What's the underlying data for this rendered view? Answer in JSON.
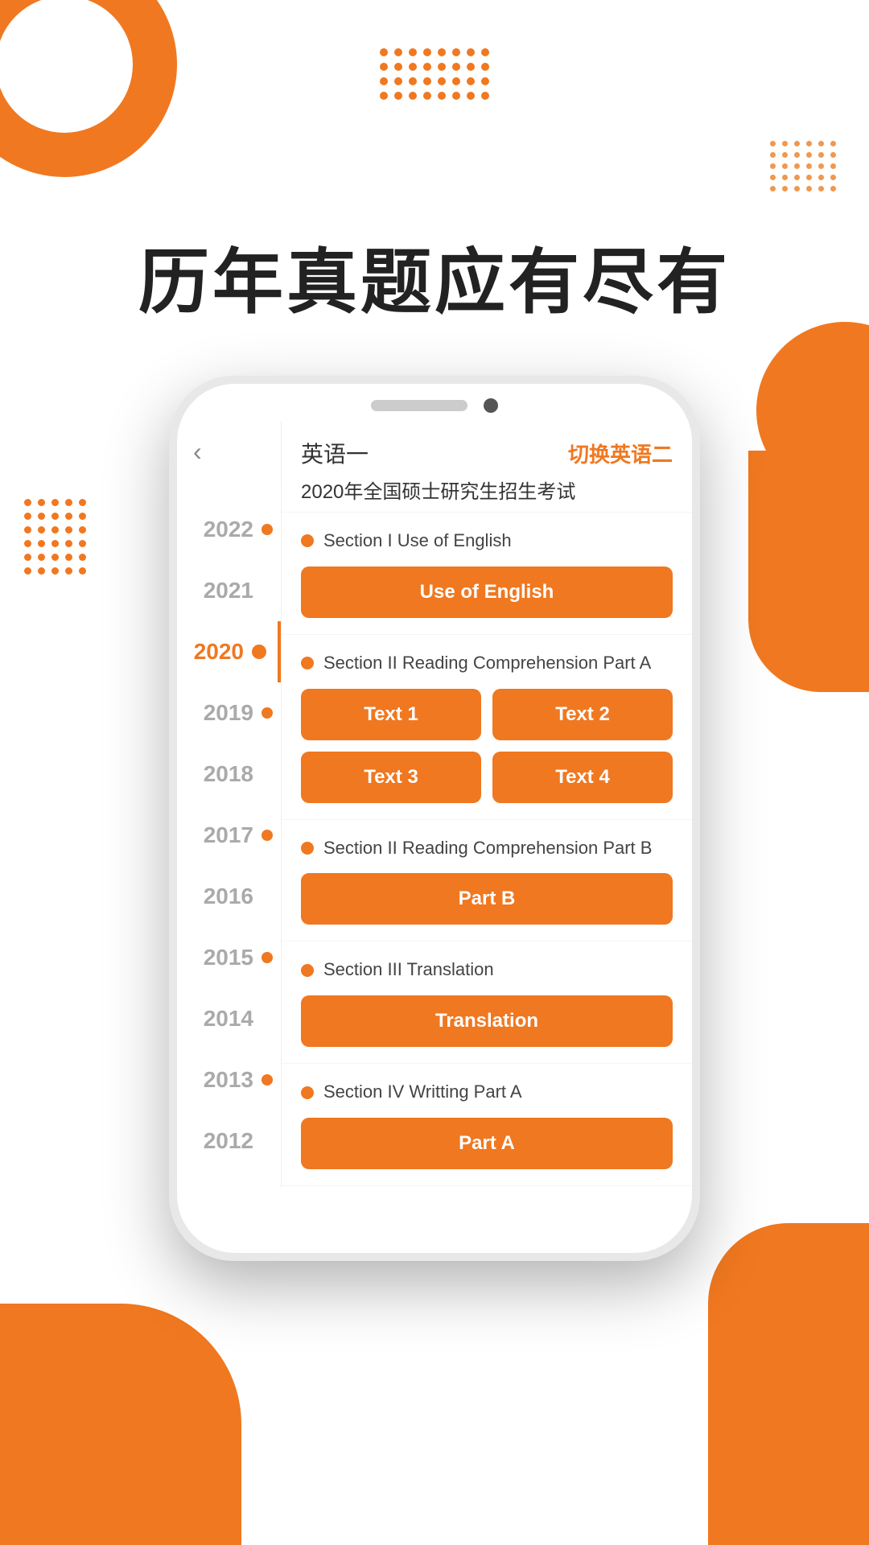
{
  "hero": {
    "title": "历年真题应有尽有"
  },
  "phone": {
    "header": {
      "exam_type": "英语一",
      "switch_label": "切换英语二",
      "exam_title": "2020年全国硕士研究生招生考试"
    },
    "years": [
      {
        "year": "2022",
        "active": false
      },
      {
        "year": "2021",
        "active": false
      },
      {
        "year": "2020",
        "active": true
      },
      {
        "year": "2019",
        "active": false
      },
      {
        "year": "2018",
        "active": false
      },
      {
        "year": "2017",
        "active": false
      },
      {
        "year": "2016",
        "active": false
      },
      {
        "year": "2015",
        "active": false
      },
      {
        "year": "2014",
        "active": false
      },
      {
        "year": "2013",
        "active": false
      },
      {
        "year": "2012",
        "active": false
      }
    ],
    "sections": [
      {
        "id": "section1",
        "title": "Section I Use of English",
        "buttons": [
          {
            "label": "Use of English",
            "wide": true
          }
        ]
      },
      {
        "id": "section2",
        "title": "Section II Reading Comprehension Part A",
        "buttons": [
          {
            "label": "Text 1",
            "wide": false
          },
          {
            "label": "Text 2",
            "wide": false
          },
          {
            "label": "Text 3",
            "wide": false
          },
          {
            "label": "Text 4",
            "wide": false
          }
        ]
      },
      {
        "id": "section3",
        "title": "Section II Reading Comprehension Part B",
        "buttons": [
          {
            "label": "Part B",
            "wide": true
          }
        ]
      },
      {
        "id": "section4",
        "title": "Section III Translation",
        "buttons": [
          {
            "label": "Translation",
            "wide": true
          }
        ]
      },
      {
        "id": "section5",
        "title": "Section IV Writting Part A",
        "buttons": [
          {
            "label": "Part A",
            "wide": true
          }
        ]
      }
    ]
  },
  "icons": {
    "back": "‹",
    "dots": "●"
  }
}
